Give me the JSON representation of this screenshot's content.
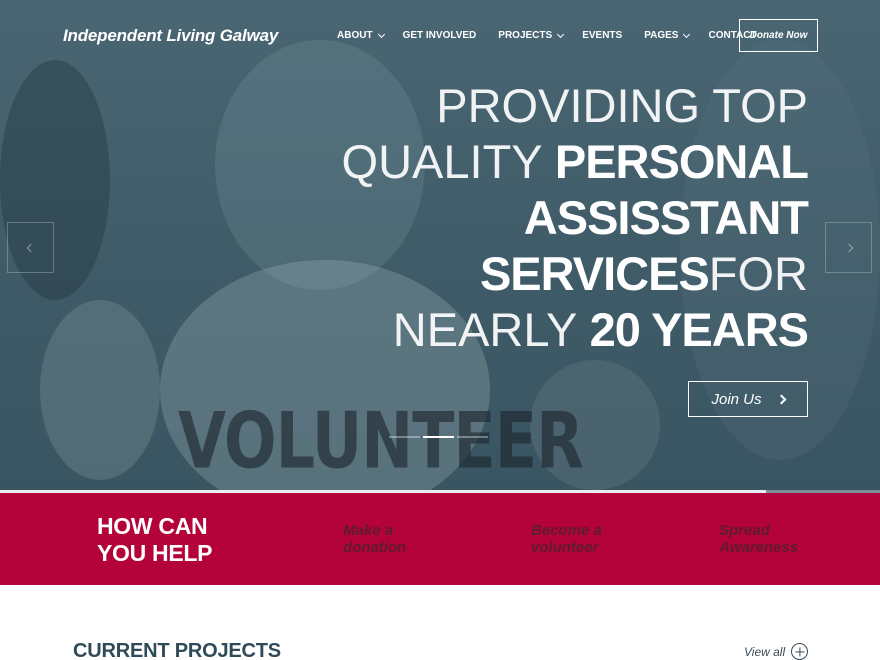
{
  "site": {
    "logo": "Independent Living Galway"
  },
  "nav": {
    "items": [
      {
        "label": "ABOUT",
        "has_dropdown": true
      },
      {
        "label": "GET INVOLVED",
        "has_dropdown": false
      },
      {
        "label": "PROJECTS",
        "has_dropdown": true
      },
      {
        "label": "EVENTS",
        "has_dropdown": false
      },
      {
        "label": "PAGES",
        "has_dropdown": true
      },
      {
        "label": "CONTACT",
        "has_dropdown": false
      }
    ],
    "donate_label": "Donate Now"
  },
  "hero": {
    "headline": {
      "line1_thin": "PROVIDING TOP",
      "line2_thin": "QUALITY ",
      "line2_bold": "PERSONAL",
      "line3_bold": "ASSISSTANT",
      "line4_bold": "SERVICES",
      "line4_thin": "FOR",
      "line5_thin": "NEARLY ",
      "line5_bold": "20 YEARS"
    },
    "cta_label": "Join Us",
    "shirt_text": "VOLUNTEER",
    "slides_total": 3,
    "active_slide": 2,
    "progress_fraction": 0.87
  },
  "help": {
    "title": "HOW CAN YOU HELP",
    "links": [
      {
        "label": "Make a donation",
        "icon": "donation-icon"
      },
      {
        "label": "Become a volunteer",
        "icon": "volunteer-icon"
      },
      {
        "label": "Spread Awareness",
        "icon": "awareness-icon"
      }
    ]
  },
  "projects": {
    "title": "CURRENT PROJECTS",
    "view_all_label": "View all"
  },
  "colors": {
    "hero_overlay": "#3f5b68",
    "brand_red": "#b4023a",
    "dark_text": "#2f4a58"
  }
}
